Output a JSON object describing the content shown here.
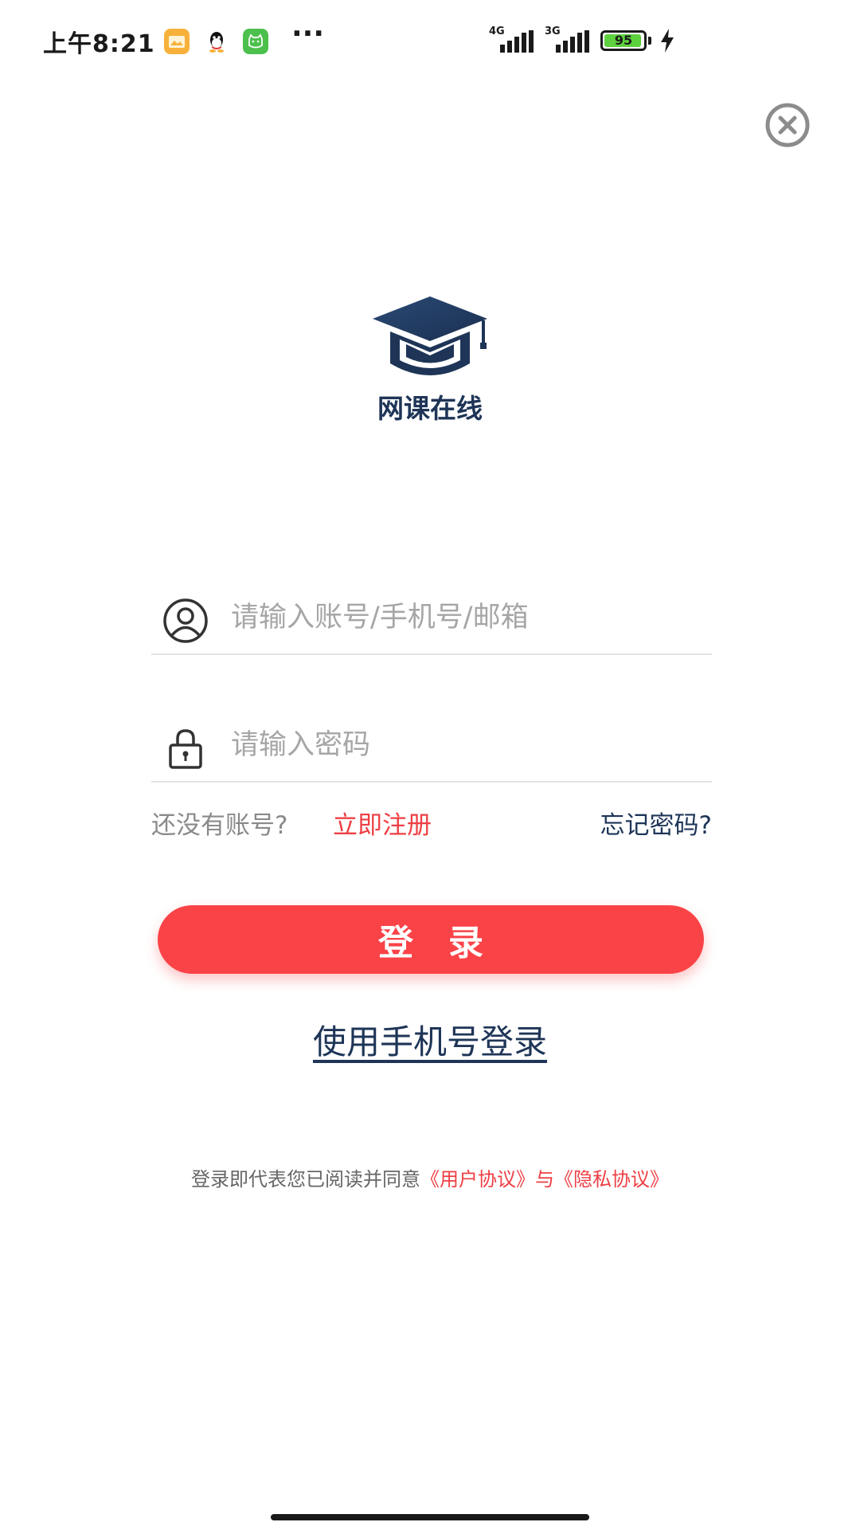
{
  "status_bar": {
    "time": "上午8:21",
    "more": "···",
    "signal_1_label": "4G",
    "signal_2_label": "3G",
    "battery_percent": "95",
    "battery_level": 0.95,
    "icons": [
      "files-icon",
      "qq-icon",
      "pet-icon",
      "signal-icon",
      "battery-icon",
      "charging-icon"
    ]
  },
  "header": {
    "close_icon": "close-circle-icon"
  },
  "logo": {
    "text": "网课在线",
    "icon": "graduation-cap-icon",
    "color": "#1e3557"
  },
  "form": {
    "account": {
      "placeholder": "请输入账号/手机号/邮箱",
      "value": "",
      "icon": "user-icon"
    },
    "password": {
      "placeholder": "请输入密码",
      "value": "",
      "icon": "lock-icon"
    },
    "no_account_text": "还没有账号?",
    "register_label": "立即注册",
    "forgot_label": "忘记密码?",
    "login_label": "登　录",
    "phone_login_label": "使用手机号登录"
  },
  "agreement": {
    "prefix": "登录即代表您已阅读并同意",
    "user_agreement": "《用户协议》",
    "and": "与",
    "privacy_agreement": "《隐私协议》"
  },
  "colors": {
    "accent": "#fa4347",
    "link_red": "#ee3f44",
    "navy": "#1e3557",
    "placeholder": "#a6a6a6"
  }
}
